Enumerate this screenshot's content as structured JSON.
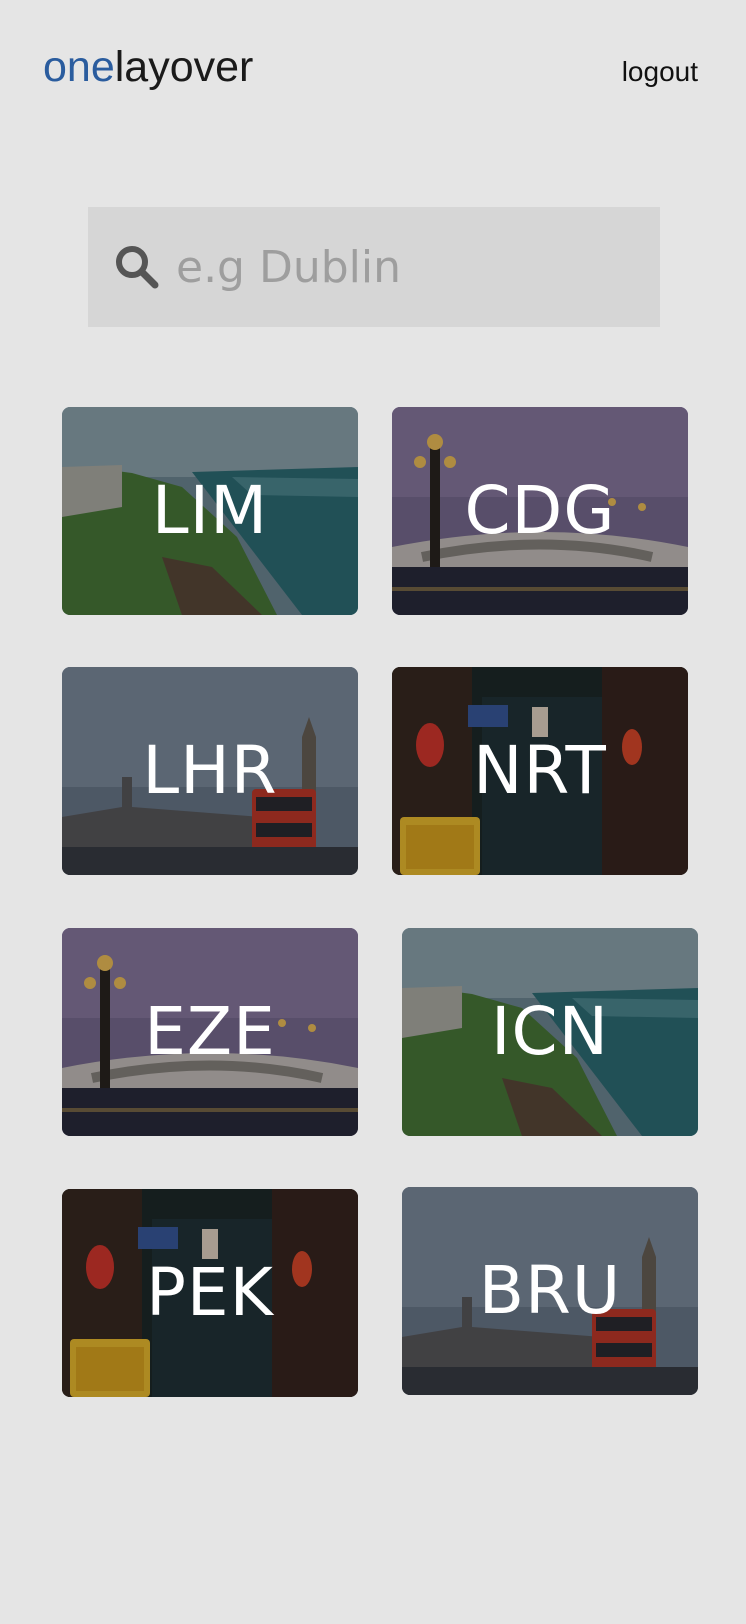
{
  "header": {
    "logo_part1": "one",
    "logo_part2": "layover",
    "logout_label": "logout"
  },
  "search": {
    "placeholder": "e.g Dublin",
    "value": ""
  },
  "airports": [
    {
      "code": "LIM",
      "scene": "coast"
    },
    {
      "code": "CDG",
      "scene": "bridge"
    },
    {
      "code": "LHR",
      "scene": "london"
    },
    {
      "code": "NRT",
      "scene": "alley"
    },
    {
      "code": "EZE",
      "scene": "bridge"
    },
    {
      "code": "ICN",
      "scene": "coast"
    },
    {
      "code": "PEK",
      "scene": "alley"
    },
    {
      "code": "BRU",
      "scene": "london"
    }
  ],
  "colors": {
    "background": "#e5e5e5",
    "logo_accent": "#2a5c9e",
    "search_bg": "#d6d6d6"
  },
  "icons": {
    "search": "search-icon"
  }
}
